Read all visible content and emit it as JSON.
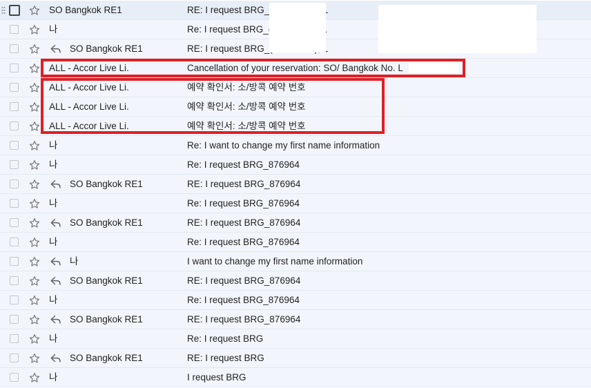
{
  "inbox": {
    "rows": [
      {
        "sender": "SO Bangkok RE1",
        "subject": "RE: I request BRG_( cancelled), L",
        "replied": false,
        "first": true
      },
      {
        "sender": "나",
        "subject": "Re: I request BRG_( cancelled), L",
        "replied": false
      },
      {
        "sender": "SO Bangkok RE1",
        "subject": "RE: I request BRG_( cancelled), L",
        "replied": true
      },
      {
        "sender": "ALL - Accor Live Li.",
        "subject": "Cancellation of your reservation: SO/ Bangkok No. L",
        "replied": false
      },
      {
        "sender": "ALL - Accor Live Li.",
        "subject": "예약 확인서: 소/방콕 예약 번호",
        "replied": false
      },
      {
        "sender": "ALL - Accor Live Li.",
        "subject": "예약 확인서: 소/방콕 예약 번호",
        "replied": false
      },
      {
        "sender": "ALL - Accor Live Li.",
        "subject": "예약 확인서: 소/방콕 예약 번호",
        "replied": false
      },
      {
        "sender": "나",
        "subject": "Re: I want to change my first name information",
        "replied": false
      },
      {
        "sender": "나",
        "subject": "Re: I request BRG_876964",
        "replied": false
      },
      {
        "sender": "SO Bangkok RE1",
        "subject": "RE: I request BRG_876964",
        "replied": true
      },
      {
        "sender": "나",
        "subject": "Re: I request BRG_876964",
        "replied": false
      },
      {
        "sender": "SO Bangkok RE1",
        "subject": "RE: I request BRG_876964",
        "replied": true
      },
      {
        "sender": "나",
        "subject": "Re: I request BRG_876964",
        "replied": false
      },
      {
        "sender": "나",
        "subject": "I want to change my first name information",
        "replied": true
      },
      {
        "sender": "SO Bangkok RE1",
        "subject": "RE: I request BRG_876964",
        "replied": true
      },
      {
        "sender": "나",
        "subject": "Re: I request BRG_876964",
        "replied": false
      },
      {
        "sender": "SO Bangkok RE1",
        "subject": "RE: I request BRG_876964",
        "replied": true
      },
      {
        "sender": "나",
        "subject": "Re: I request BRG",
        "replied": false
      },
      {
        "sender": "SO Bangkok RE1",
        "subject": "RE: I request BRG",
        "replied": true
      },
      {
        "sender": "나",
        "subject": "I request BRG",
        "replied": false
      }
    ]
  },
  "icons": {
    "checkbox": "checkbox-icon",
    "star": "star-outline-icon",
    "reply": "reply-arrow-icon",
    "drag": "drag-handle-icon"
  },
  "colors": {
    "highlight": "#e01f26",
    "row_bg": "#f2f6fc",
    "text": "#1f1f1f"
  }
}
